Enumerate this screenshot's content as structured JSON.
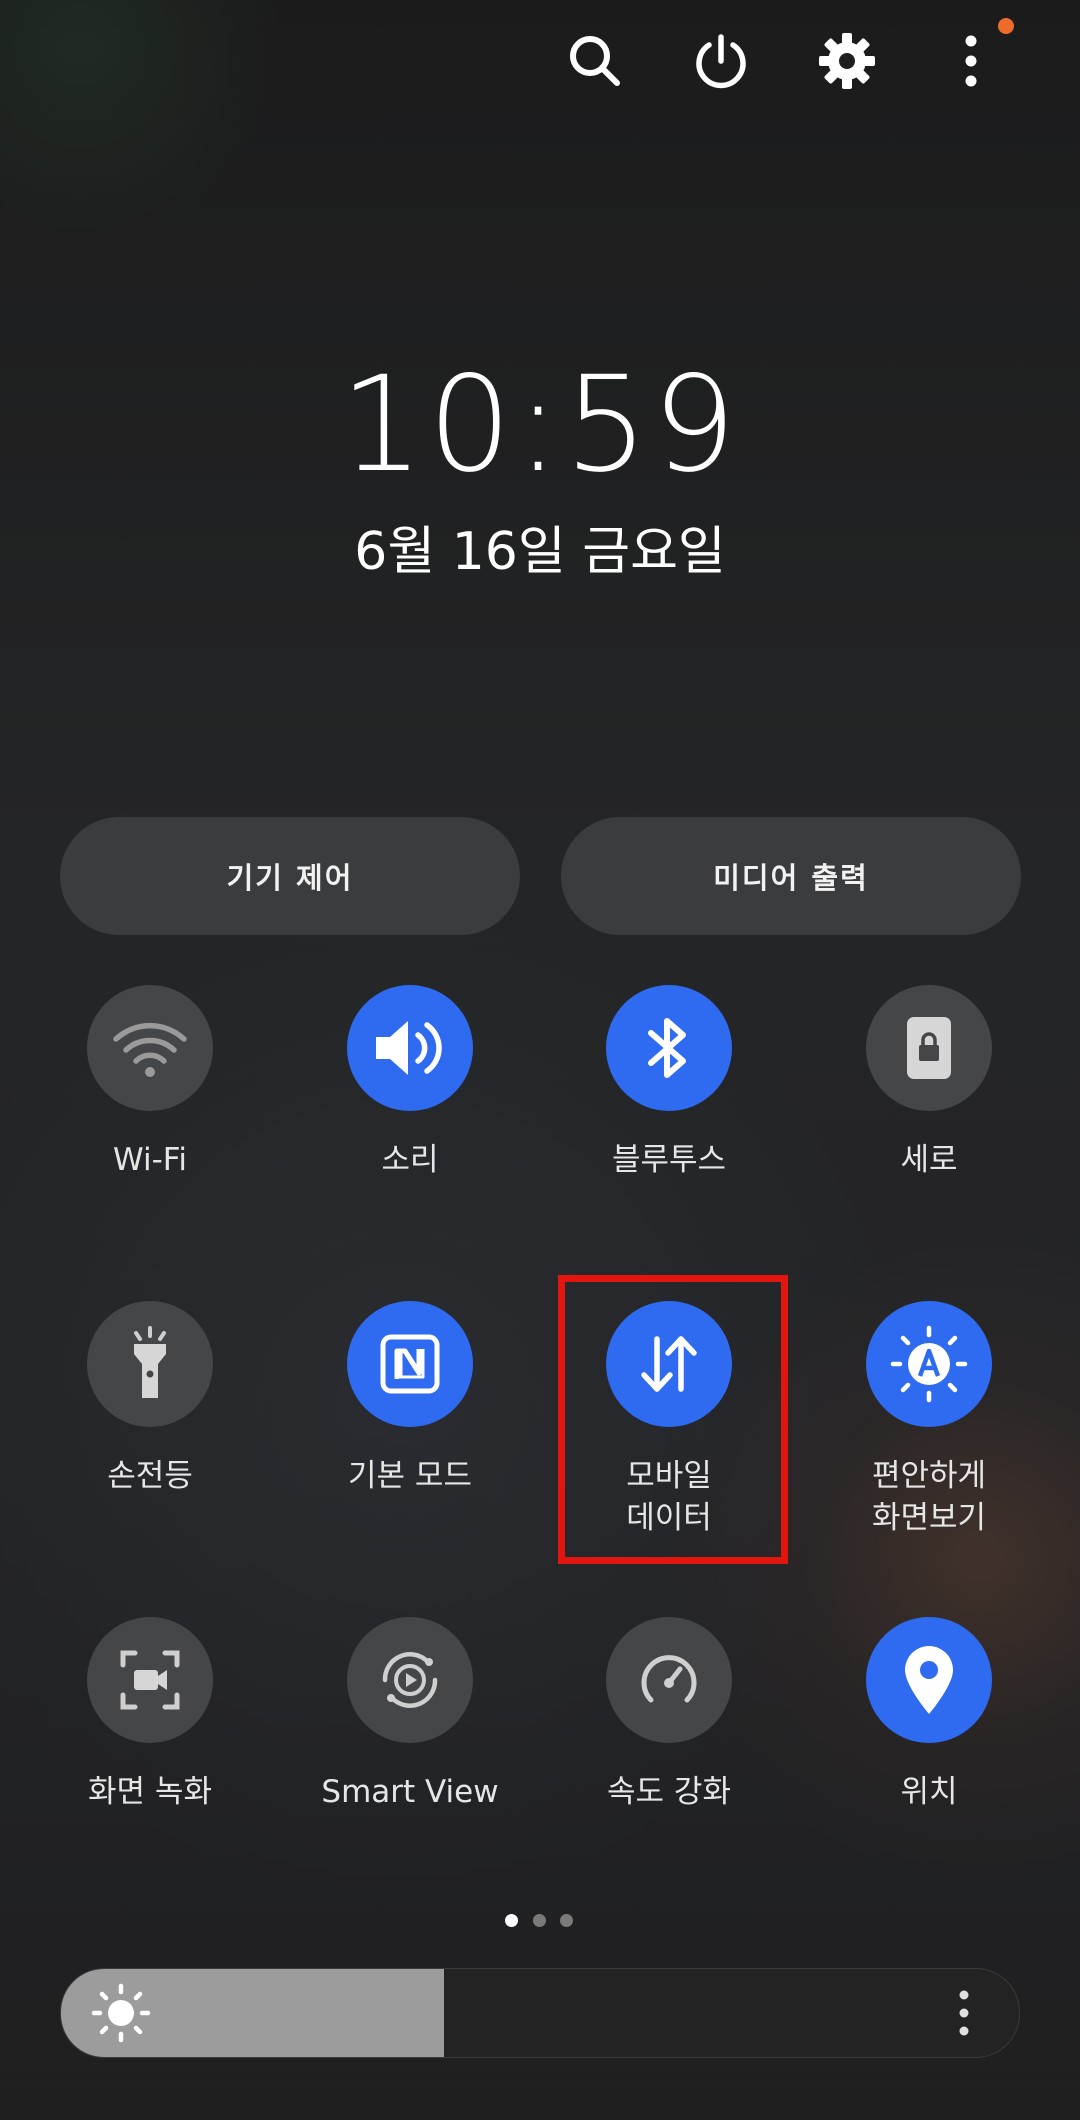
{
  "top_bar": {
    "icons": [
      "search-icon",
      "power-icon",
      "settings-icon",
      "more-options-icon"
    ],
    "notification_color": "#ee6b2a"
  },
  "clock": {
    "time": "10:59",
    "date": "6월 16일 금요일"
  },
  "pills": {
    "device_control": "기기 제어",
    "media_output": "미디어 출력"
  },
  "tiles": [
    {
      "label": "Wi-Fi",
      "label2": "",
      "on": false,
      "icon": "wifi-icon"
    },
    {
      "label": "소리",
      "label2": "",
      "on": true,
      "icon": "sound-icon"
    },
    {
      "label": "블루투스",
      "label2": "",
      "on": true,
      "icon": "bluetooth-icon"
    },
    {
      "label": "세로",
      "label2": "",
      "on": false,
      "icon": "portrait-lock-icon"
    },
    {
      "label": "손전등",
      "label2": "",
      "on": false,
      "icon": "flashlight-icon"
    },
    {
      "label": "기본 모드",
      "label2": "",
      "on": true,
      "icon": "nfc-icon"
    },
    {
      "label": "모바일",
      "label2": "데이터",
      "on": true,
      "icon": "mobile-data-icon"
    },
    {
      "label": "편안하게",
      "label2": "화면보기",
      "on": true,
      "icon": "eye-comfort-icon"
    },
    {
      "label": "화면 녹화",
      "label2": "",
      "on": false,
      "icon": "screen-record-icon"
    },
    {
      "label": "Smart View",
      "label2": "",
      "on": false,
      "icon": "smart-view-icon"
    },
    {
      "label": "속도 강화",
      "label2": "",
      "on": false,
      "icon": "speed-boost-icon"
    },
    {
      "label": "위치",
      "label2": "",
      "on": true,
      "icon": "location-icon"
    }
  ],
  "page_indicator": {
    "current": 1,
    "total": 3
  },
  "brightness": {
    "level": 0.4
  },
  "colors": {
    "accent": "#2e6bf0",
    "tile_off": "#454648",
    "highlight": "#e0160f"
  }
}
